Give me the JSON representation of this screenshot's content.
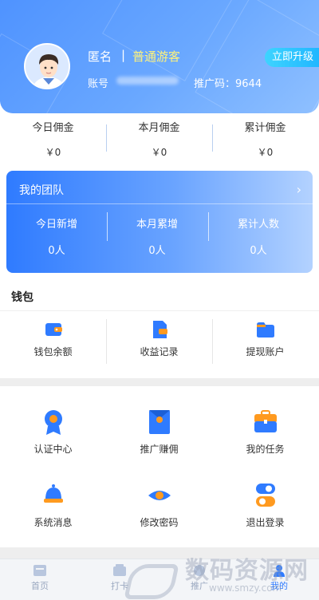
{
  "profile": {
    "nickname": "匿名",
    "separator": "|",
    "level": "普通游客",
    "account_label": "账号",
    "promo_code": "推广码：9644",
    "upgrade_label": "立即升级"
  },
  "commission": [
    {
      "title": "今日佣金",
      "value": "￥0"
    },
    {
      "title": "本月佣金",
      "value": "￥0"
    },
    {
      "title": "累计佣金",
      "value": "￥0"
    }
  ],
  "team": {
    "title": "我的团队",
    "chevron": "›",
    "stats": [
      {
        "label": "今日新增",
        "value": "0人"
      },
      {
        "label": "本月累增",
        "value": "0人"
      },
      {
        "label": "累计人数",
        "value": "0人"
      }
    ]
  },
  "wallet": {
    "title": "钱包",
    "items": [
      {
        "label": "钱包余额",
        "icon": "wallet-icon"
      },
      {
        "label": "收益记录",
        "icon": "income-record-icon"
      },
      {
        "label": "提现账户",
        "icon": "withdraw-account-icon"
      }
    ]
  },
  "grid": [
    {
      "label": "认证中心",
      "icon": "certification-icon"
    },
    {
      "label": "推广赚佣",
      "icon": "promote-icon"
    },
    {
      "label": "我的任务",
      "icon": "task-icon"
    },
    {
      "label": "系统消息",
      "icon": "bell-icon"
    },
    {
      "label": "修改密码",
      "icon": "eye-icon"
    },
    {
      "label": "退出登录",
      "icon": "logout-toggle-icon"
    }
  ],
  "tabbar": [
    {
      "label": "首页",
      "icon": "home-icon"
    },
    {
      "label": "打卡",
      "icon": "clock-in-icon"
    },
    {
      "label": "推广",
      "icon": "promote-tab-icon"
    },
    {
      "label": "我的",
      "icon": "profile-tab-icon"
    }
  ],
  "watermark": {
    "text": "数码资源网",
    "url": "www.smzy.com"
  },
  "colors": {
    "primary": "#2f7bff",
    "accent_yellow": "#fff37a",
    "orange": "#ff9a1f",
    "upgrade": "#20b6ff"
  }
}
